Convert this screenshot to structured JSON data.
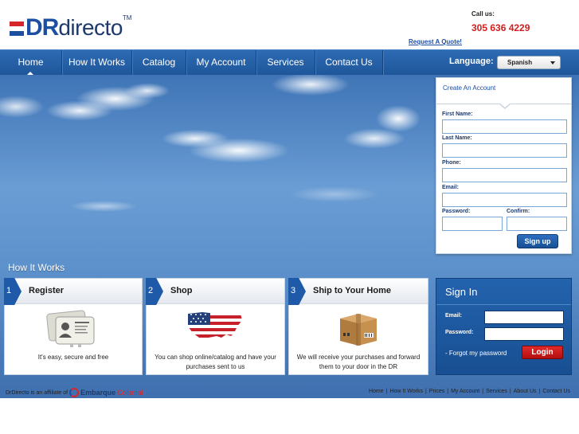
{
  "header": {
    "logo_text_dr": "DR",
    "logo_text_directo": "directo",
    "logo_tm": "TM",
    "call_us": "Call us:",
    "phone": "305 636 4229",
    "request_quote": "Request A Quote!"
  },
  "nav": {
    "items": [
      "Home",
      "How It Works",
      "Catalog",
      "My Account",
      "Services",
      "Contact Us"
    ],
    "active": "Home",
    "language_label": "Language:",
    "language_value": "Spanish"
  },
  "create_account": {
    "title": "Create An Account",
    "first_name": "First Name:",
    "last_name": "Last Name:",
    "phone": "Phone:",
    "email": "Email:",
    "password": "Password:",
    "confirm": "Confirm:",
    "signup": "Sign up"
  },
  "how_it_works": {
    "title": "How It Works",
    "steps": [
      {
        "num": "1",
        "title": "Register",
        "desc": "It's easy, secure and free",
        "icon": "id-card-icon"
      },
      {
        "num": "2",
        "title": "Shop",
        "desc": "You can shop online/catalog and have your purchases sent to us",
        "icon": "usa-flag-map-icon"
      },
      {
        "num": "3",
        "title": "Ship to Your Home",
        "desc": "We will receive your purchases and forward them to your door in the DR",
        "icon": "shipping-box-icon"
      }
    ]
  },
  "signin": {
    "title": "Sign In",
    "email": "Email:",
    "password": "Password:",
    "forgot": "- Forgot my password",
    "login": "Login"
  },
  "footer": {
    "affiliate_text": "DrDirecto is an affiliate of",
    "affiliate_brand_1": "Embarque",
    "affiliate_brand_2": "Colonial",
    "links": [
      "Home",
      "How It Works",
      "Prices",
      "My Account",
      "Services",
      "About Us",
      "Contact Us"
    ]
  },
  "colors": {
    "brand_blue": "#1c4ea1",
    "brand_red": "#d6262b",
    "nav_blue": "#2d6bb3",
    "login_red": "#c81a1a"
  }
}
